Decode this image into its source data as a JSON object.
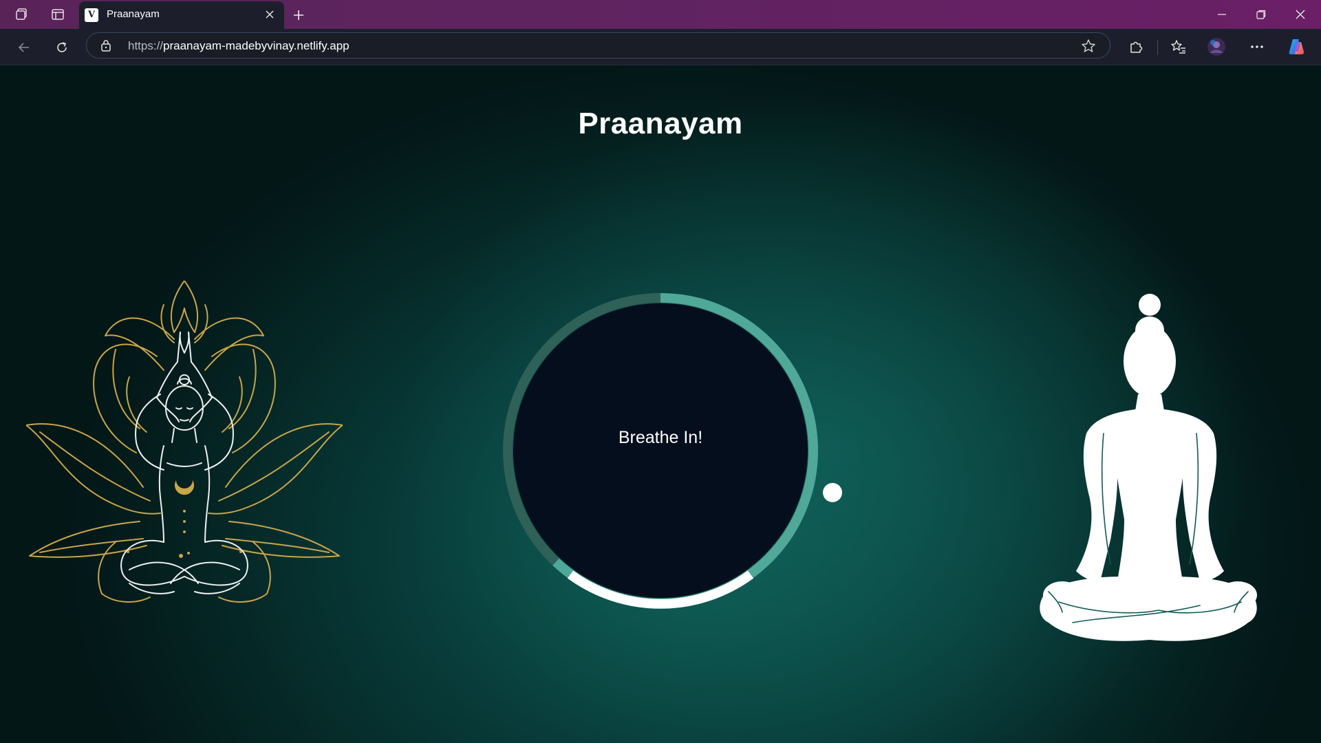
{
  "browser": {
    "tab": {
      "title": "Praanayam",
      "favicon_text": "V"
    },
    "address": {
      "protocol": "https://",
      "host": "praanayam-madebyvinay.netlify.app"
    }
  },
  "page": {
    "title": "Praanayam",
    "breath_label": "Breathe In!",
    "breath_progress": 0.62
  },
  "icons": {
    "workspaces": "workspaces-icon",
    "tab_actions": "tab-actions-icon",
    "close_tab": "close-icon",
    "new_tab": "plus-icon",
    "minimize": "minimize-icon",
    "restore": "restore-icon",
    "close_window": "close-icon",
    "back": "back-arrow-icon",
    "reload": "reload-icon",
    "lock": "lock-icon",
    "favorite": "star-icon",
    "extensions": "puzzle-icon",
    "favorites": "favorites-icon",
    "profile": "avatar",
    "more": "more-icon",
    "copilot": "copilot-icon"
  },
  "colors": {
    "accent_teal": "#4fa898",
    "track_dark": "#2f6158",
    "circle_fill": "#040e1c",
    "lotus_gold": "#c9a64a"
  }
}
